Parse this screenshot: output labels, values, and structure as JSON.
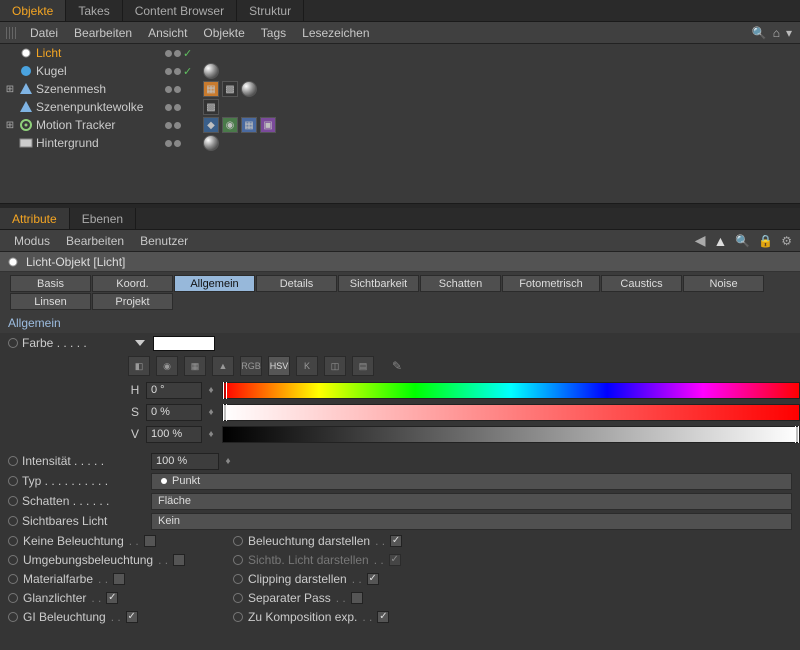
{
  "top_tabs": {
    "objekte": "Objekte",
    "takes": "Takes",
    "content_browser": "Content Browser",
    "struktur": "Struktur"
  },
  "obj_menubar": {
    "datei": "Datei",
    "bearbeiten": "Bearbeiten",
    "ansicht": "Ansicht",
    "objekte": "Objekte",
    "tags": "Tags",
    "lesezeichen": "Lesezeichen"
  },
  "tree": {
    "items": [
      {
        "name": "Licht",
        "selected": true
      },
      {
        "name": "Kugel"
      },
      {
        "name": "Szenenmesh"
      },
      {
        "name": "Szenenpunktewolke"
      },
      {
        "name": "Motion Tracker"
      },
      {
        "name": "Hintergrund"
      }
    ]
  },
  "attr_tabs": {
    "attribute": "Attribute",
    "ebenen": "Ebenen"
  },
  "attr_menubar": {
    "modus": "Modus",
    "bearbeiten": "Bearbeiten",
    "benutzer": "Benutzer"
  },
  "obj_header": "Licht-Objekt [Licht]",
  "ptabs": {
    "basis": "Basis",
    "koord": "Koord.",
    "allgemein": "Allgemein",
    "details": "Details",
    "sichtbarkeit": "Sichtbarkeit",
    "schatten": "Schatten",
    "fotometrisch": "Fotometrisch",
    "caustics": "Caustics",
    "noise": "Noise",
    "linsen": "Linsen",
    "projekt": "Projekt"
  },
  "section": "Allgemein",
  "params": {
    "farbe_label": "Farbe",
    "ctoolbar": {
      "rgb": "RGB",
      "hsv": "HSV",
      "k": "K"
    },
    "hsv": {
      "h_label": "H",
      "h_value": "0 °",
      "s_label": "S",
      "s_value": "0 %",
      "v_label": "V",
      "v_value": "100 %"
    },
    "intensitaet_label": "Intensität",
    "intensitaet_value": "100 %",
    "typ_label": "Typ",
    "typ_value": "Punkt",
    "schatten_label": "Schatten",
    "schatten_value": "Fläche",
    "sichtlicht_label": "Sichtbares Licht",
    "sichtlicht_value": "Kein",
    "chk_left": [
      {
        "label": "Keine Beleuchtung",
        "checked": false
      },
      {
        "label": "Umgebungsbeleuchtung",
        "checked": false
      },
      {
        "label": "Materialfarbe",
        "checked": false
      },
      {
        "label": "Glanzlichter",
        "checked": true
      },
      {
        "label": "GI Beleuchtung",
        "checked": true
      }
    ],
    "chk_right": [
      {
        "label": "Beleuchtung darstellen",
        "checked": true,
        "disabled": false
      },
      {
        "label": "Sichtb. Licht darstellen",
        "checked": true,
        "disabled": true
      },
      {
        "label": "Clipping darstellen",
        "checked": true,
        "disabled": false
      },
      {
        "label": "Separater Pass",
        "checked": false,
        "disabled": false
      },
      {
        "label": "Zu Komposition exp.",
        "checked": true,
        "disabled": false
      }
    ]
  }
}
